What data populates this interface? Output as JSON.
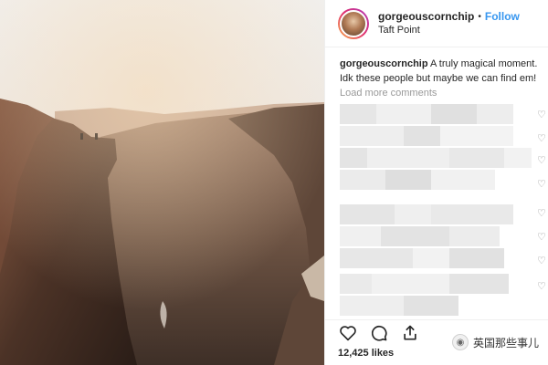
{
  "header": {
    "username": "gorgeouscornchip",
    "separator": "•",
    "follow_label": "Follow",
    "location": "Taft Point"
  },
  "caption": {
    "username": "gorgeouscornchip",
    "text": " A truly magical moment. Idk these people but maybe we can find em!"
  },
  "load_more_label": "Load more comments",
  "comment_heart_icon": "heart-outline-icon",
  "actions": {
    "icons": [
      "heart-icon",
      "comment-icon",
      "share-icon"
    ]
  },
  "likes": "12,425 likes",
  "watermark": {
    "badge": "◉",
    "text": "英国那些事儿"
  },
  "colors": {
    "link": "#3897f0",
    "muted": "#999999",
    "text": "#262626"
  }
}
